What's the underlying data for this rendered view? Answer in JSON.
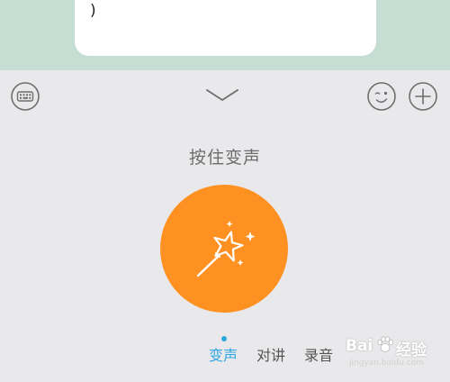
{
  "chat": {
    "bubble_text": ")"
  },
  "panel": {
    "hint": "按住变声",
    "record_button_color": "#ff9123",
    "tabs": [
      {
        "label": "变声",
        "active": true
      },
      {
        "label": "对讲",
        "active": false
      },
      {
        "label": "录音",
        "active": false
      }
    ],
    "toolbar": {
      "left_icon": "keyboard-icon",
      "center_icon": "chevron-down-icon",
      "emoji_icon": "emoji-wink-icon",
      "plus_icon": "plus-icon",
      "record_icon": "magic-wand-icon"
    }
  },
  "watermark": {
    "brand_latin": "Bai",
    "brand_cn": "经验",
    "url": "jingyan.baidu.com"
  },
  "colors": {
    "accent": "#2ea5e0",
    "record": "#ff9123",
    "chat_bg": "#c6ddd3",
    "panel_bg": "#e9e9eb"
  }
}
